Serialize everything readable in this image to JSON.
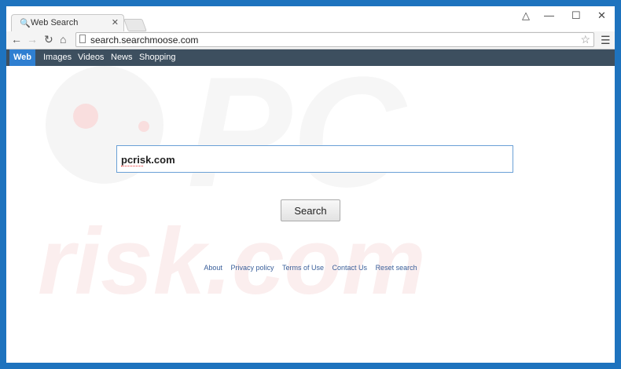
{
  "tab": {
    "title": "Web Search",
    "icon": "magnifier-icon"
  },
  "address": {
    "url": "search.searchmoose.com"
  },
  "nav": {
    "items": [
      {
        "label": "Web",
        "active": true
      },
      {
        "label": "Images",
        "active": false
      },
      {
        "label": "Videos",
        "active": false
      },
      {
        "label": "News",
        "active": false
      },
      {
        "label": "Shopping",
        "active": false
      }
    ]
  },
  "search": {
    "query": "pcrisk.com",
    "button_label": "Search"
  },
  "footer": {
    "links": [
      "About",
      "Privacy policy",
      "Terms of Use",
      "Contact Us",
      "Reset search"
    ]
  },
  "watermark": {
    "top": "PC",
    "bottom": "risk.com"
  },
  "colors": {
    "frame": "#1e73be",
    "navbar": "#3d4f5f",
    "nav_active": "#2f7fd1",
    "link": "#3a5f9a"
  }
}
